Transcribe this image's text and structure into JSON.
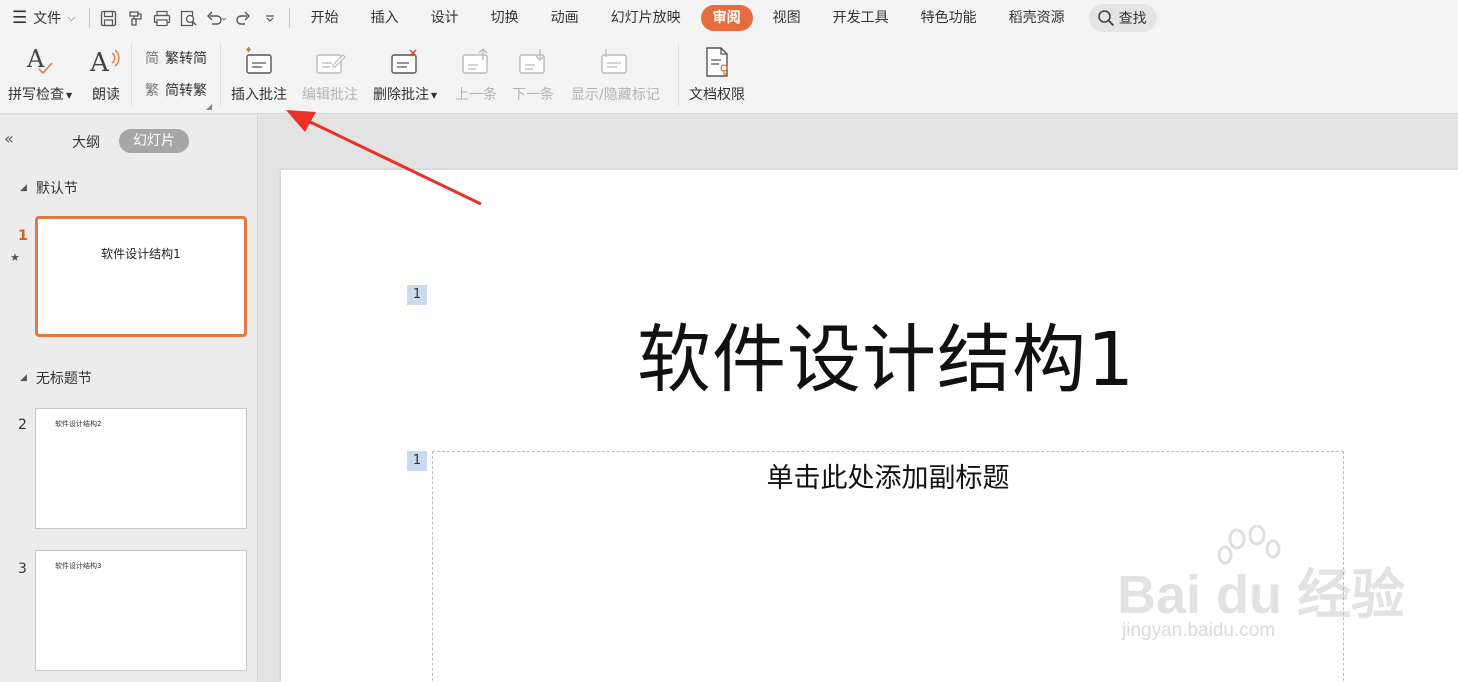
{
  "menubar": {
    "file_label": "文件",
    "tabs": [
      "开始",
      "插入",
      "设计",
      "切换",
      "动画",
      "幻灯片放映",
      "审阅",
      "视图",
      "开发工具",
      "特色功能",
      "稻壳资源"
    ],
    "active_tab": "审阅",
    "search_label": "查找"
  },
  "ribbon": {
    "spellcheck": "拼写检查",
    "read_aloud": "朗读",
    "trad_to_simp": "繁转简",
    "simp_to_trad": "简转繁",
    "insert_comment": "插入批注",
    "edit_comment": "编辑批注",
    "delete_comment": "删除批注",
    "prev_item": "上一条",
    "next_item": "下一条",
    "toggle_marks": "显示/隐藏标记",
    "doc_permissions": "文档权限"
  },
  "leftpane": {
    "tab_outline": "大纲",
    "tab_slides": "幻灯片",
    "sections": [
      {
        "name": "默认节"
      },
      {
        "name": "无标题节"
      }
    ],
    "slides": [
      {
        "number": "1",
        "title": "软件设计结构1"
      },
      {
        "number": "2",
        "title": "软件设计结构2"
      },
      {
        "number": "3",
        "title": "软件设计结构3"
      }
    ]
  },
  "slide": {
    "comment_marker_1": "1",
    "comment_marker_2": "1",
    "title": "软件设计结构1",
    "subtitle_placeholder": "单击此处添加副标题"
  },
  "watermark": {
    "logo": "Bai du 经验",
    "url": "jingyan.baidu.com"
  },
  "colors": {
    "accent": "#e86d3e",
    "annotation_arrow": "#e8312a",
    "comment_marker": "#c9d9ee"
  }
}
